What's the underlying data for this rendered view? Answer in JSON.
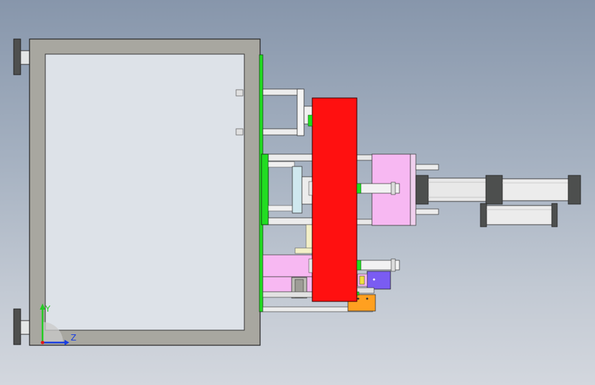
{
  "viewport": {
    "background_top": "#8796ab",
    "background_bottom": "#d3d7de"
  },
  "model": {
    "frame_color": "#a8a7a0",
    "window_color": "#dde2e8",
    "plate_color": "#ff1010",
    "green_color": "#22dd22",
    "pink_color": "#f7b8f2",
    "orange_color": "#ffa020",
    "purple_color": "#7a5cf2",
    "cylinder_color": "#e8e8e8",
    "dark_cap_color": "#4d4f4e"
  },
  "triad": {
    "y_axis_label": "Y",
    "z_axis_label": "Z",
    "y_color": "#22cc22",
    "z_color": "#1a3fe0",
    "x_color": "#e01818"
  }
}
